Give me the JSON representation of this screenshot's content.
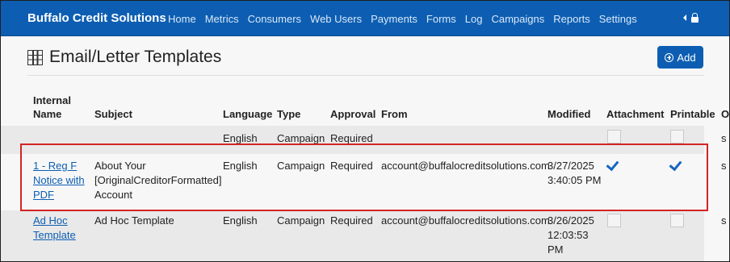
{
  "navbar": {
    "brand": "Buffalo Credit Solutions",
    "items": [
      "Home",
      "Metrics",
      "Consumers",
      "Web Users",
      "Payments",
      "Forms",
      "Log",
      "Campaigns",
      "Reports",
      "Settings"
    ]
  },
  "page": {
    "title": "Email/Letter Templates",
    "add_label": "Add"
  },
  "table": {
    "headers": {
      "internal_name_line1": "Internal",
      "internal_name_line2": "Name",
      "subject": "Subject",
      "language": "Language",
      "type": "Type",
      "approval": "Approval",
      "from": "From",
      "modified": "Modified",
      "attachment": "Attachment",
      "printable": "Printable",
      "overflow": "O"
    },
    "rows": [
      {
        "name": "",
        "subject": "",
        "language": "English",
        "type": "Campaign",
        "approval": "Required",
        "from": "",
        "modified": "",
        "attachment": false,
        "printable": false,
        "overflow": "s"
      },
      {
        "name_lines": [
          "1 - Reg F",
          "Notice with",
          "PDF"
        ],
        "subject_lines": [
          "About Your",
          "[OriginalCreditorFormatted]",
          "Account"
        ],
        "language": "English",
        "type": "Campaign",
        "approval": "Required",
        "from": "account@buffalocreditsolutions.com",
        "modified_lines": [
          "3/27/2025",
          "3:40:05 PM"
        ],
        "attachment": true,
        "printable": true,
        "overflow": "s"
      },
      {
        "name_lines": [
          "Ad Hoc",
          "Template"
        ],
        "subject": "Ad Hoc Template",
        "language": "English",
        "type": "Campaign",
        "approval": "Required",
        "from": "account@buffalocreditsolutions.com",
        "modified_lines": [
          "3/26/2025",
          "12:03:53",
          "PM"
        ],
        "attachment": false,
        "printable": false,
        "overflow": "s"
      }
    ]
  },
  "colors": {
    "navbar": "#0d5eb2",
    "highlight": "#d32424",
    "link": "#0d5eb2"
  }
}
